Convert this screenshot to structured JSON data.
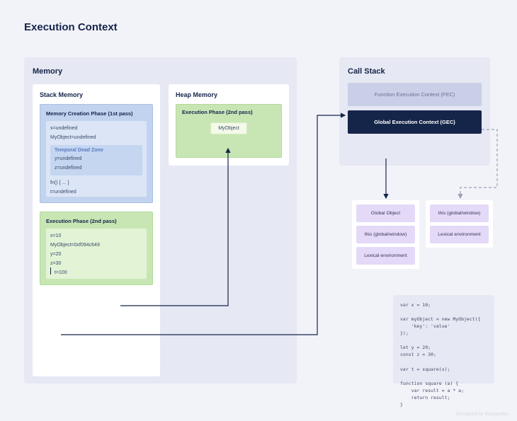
{
  "title": "Execution Context",
  "memory": {
    "label": "Memory",
    "stack": {
      "label": "Stack Memory",
      "creation": {
        "header": "Memory Creation Phase (1st pass)",
        "vars_pre_tdz": [
          "x=undefined",
          "MyObject=undefined"
        ],
        "tdz": {
          "header": "Temporal Dead Zone",
          "vars": [
            "y=undefined",
            "z=undefined"
          ]
        },
        "vars_post_tdz": [
          "fn() { ... }",
          "t=undefined"
        ]
      },
      "execution": {
        "header": "Execution Phase (2nd pass)",
        "lines": [
          "x=10",
          "MyObject=0xf094c649",
          "y=20",
          "z=30",
          "t=100"
        ]
      }
    },
    "heap": {
      "label": "Heap Memory",
      "execution": {
        "header": "Execution Phase (2nd pass)",
        "object": "MyObject"
      }
    }
  },
  "callstack": {
    "label": "Call Stack",
    "fec": "Function Execution Context (FEC)",
    "gec": "Global Execution Context (GEC)"
  },
  "gec_card": {
    "slots": [
      "Global Object",
      "this (global/window)",
      "Lexical environment"
    ]
  },
  "fec_card": {
    "slots": [
      "this (global/window)",
      "Lexical environment"
    ]
  },
  "code": "var x = 10;\n\nvar myObject = new MyObject({\n    'key': 'value'\n});\n\nlet y = 20;\nconst z = 30;\n\nvar t = square(x);\n\nfunction square (a) {\n    var result = a * a;\n    return result;\n}",
  "credit": "Designed by Maxgwebs"
}
